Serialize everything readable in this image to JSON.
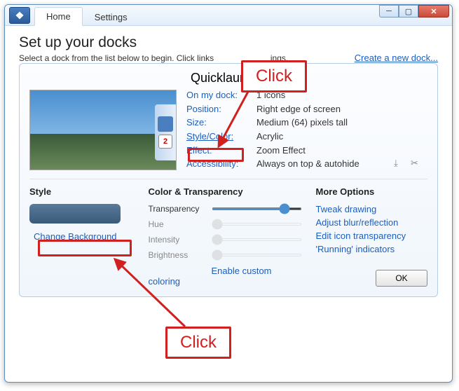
{
  "titlebar": {
    "tabs": {
      "home": "Home",
      "settings": "Settings"
    },
    "app_icon_glyph": "❖"
  },
  "page": {
    "title": "Set up your docks",
    "subtitle_a": "Select a dock from the list below to begin. Click links",
    "subtitle_b": "ings.",
    "create_link": "Create a new dock..."
  },
  "dock": {
    "title": "Quicklaunch Dock",
    "preview_cal": "2",
    "labels": {
      "on_my_dock": "On my dock:",
      "position": "Position:",
      "size": "Size:",
      "style_color": "Style/Color:",
      "effect": "Effect:",
      "accessibility": "Accessibility:"
    },
    "values": {
      "on_my_dock": "1 icons",
      "position": "Right edge of screen",
      "size": "Medium (64) pixels tall",
      "style_color": "Acrylic",
      "effect": "Zoom Effect",
      "accessibility": "Always on top & autohide"
    }
  },
  "bottom": {
    "style": {
      "title": "Style",
      "change_bg": "Change Background"
    },
    "ct": {
      "title": "Color & Transparency",
      "transparency": "Transparency",
      "hue": "Hue",
      "intensity": "Intensity",
      "brightness": "Brightness",
      "enable": "Enable custom coloring"
    },
    "more": {
      "title": "More Options",
      "tweak": "Tweak drawing",
      "blur": "Adjust blur/reflection",
      "icon_trans": "Edit icon transparency",
      "running": "'Running' indicators",
      "ok": "OK"
    }
  },
  "callouts": {
    "click1": "Click",
    "click2": "Click"
  }
}
